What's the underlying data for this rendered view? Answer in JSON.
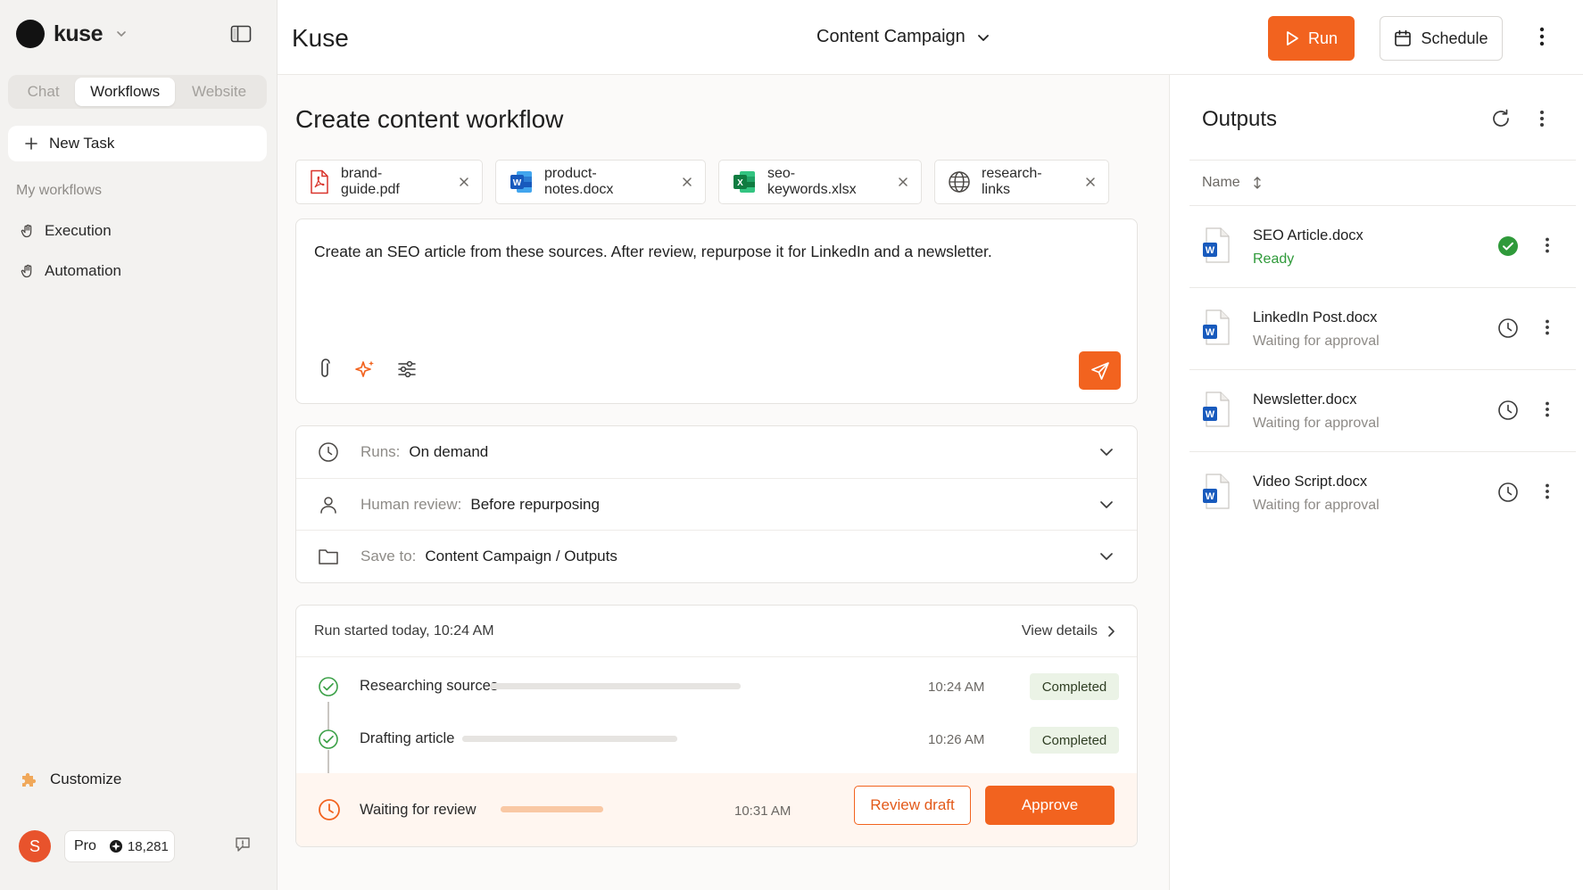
{
  "brand": {
    "name": "kuse"
  },
  "sidebar": {
    "tabs": [
      "Chat",
      "Workflows",
      "Website"
    ],
    "active_tab": "Workflows",
    "new_task_label": "New Task",
    "section_label": "My workflows",
    "items": [
      {
        "label": "Execution",
        "icon": "hand-icon"
      },
      {
        "label": "Automation",
        "icon": "hand-icon"
      }
    ],
    "customize_label": "Customize",
    "user": {
      "initial": "S",
      "plan": "Pro",
      "credits": "18,281"
    }
  },
  "topbar": {
    "app_title": "Kuse",
    "campaign": "Content Campaign",
    "run_label": "Run",
    "schedule_label": "Schedule"
  },
  "main": {
    "title": "Create content workflow",
    "attachments": [
      {
        "name": "brand-guide.pdf",
        "icon": "pdf-icon"
      },
      {
        "name": "product-notes.docx",
        "icon": "word-icon"
      },
      {
        "name": "seo-keywords.xlsx",
        "icon": "excel-icon"
      },
      {
        "name": "research-links",
        "icon": "globe-icon"
      }
    ],
    "prompt": "Create an SEO article from these sources. After review, repurpose it for LinkedIn and a newsletter.",
    "settings": [
      {
        "label": "Runs:",
        "value": "On demand",
        "icon": "clock-icon"
      },
      {
        "label": "Human review:",
        "value": "Before repurposing",
        "icon": "person-icon"
      },
      {
        "label": "Save to:",
        "value": "Content Campaign / Outputs",
        "icon": "folder-icon"
      }
    ],
    "run": {
      "started": "Run started today, 10:24 AM",
      "view_details": "View details",
      "steps": [
        {
          "name": "Researching sources",
          "time": "10:24 AM",
          "status": "Completed",
          "progress": 1.0
        },
        {
          "name": "Drafting article",
          "time": "10:26 AM",
          "status": "Completed",
          "progress": 1.0
        },
        {
          "name": "Waiting for review",
          "time": "10:31 AM",
          "status": "",
          "progress": 1.0
        }
      ],
      "review_label": "Review draft",
      "approve_label": "Approve"
    }
  },
  "outputs": {
    "title": "Outputs",
    "column_name": "Name",
    "items": [
      {
        "name": "SEO Article.docx",
        "status": "Ready",
        "state": "ready"
      },
      {
        "name": "LinkedIn Post.docx",
        "status": "Waiting for approval",
        "state": "waiting"
      },
      {
        "name": "Newsletter.docx",
        "status": "Waiting for approval",
        "state": "waiting"
      },
      {
        "name": "Video Script.docx",
        "status": "Waiting for approval",
        "state": "waiting"
      }
    ]
  },
  "colors": {
    "accent": "#f2631f",
    "success": "#2f9a3a",
    "completed_badge_bg": "#ebf3e6",
    "sidebar_bg": "#f3f2f0"
  }
}
